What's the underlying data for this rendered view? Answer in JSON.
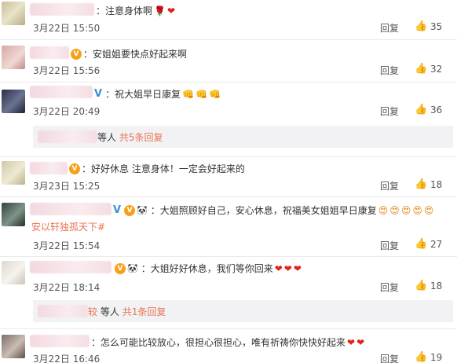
{
  "labels": {
    "reply": "回复",
    "like_icon": "thumbs-up-icon"
  },
  "comments": [
    {
      "text": "：注意身体啊",
      "emojis": [
        "🌹",
        "❤"
      ],
      "time": "3月22日 15:50",
      "likes": "35"
    },
    {
      "text": "：安姐姐要快点好起来啊",
      "emojis": [],
      "time": "3月22日 15:56",
      "likes": "32"
    },
    {
      "text": "：祝大姐早日康复",
      "emojis": [
        "👊",
        "👊",
        "👊"
      ],
      "time": "3月22日 20:49",
      "likes": "36",
      "sub": {
        "suffix": "等人",
        "link": "共5条回复"
      }
    },
    {
      "text": "：好好休息 注意身体！一定会好起来的",
      "emojis": [],
      "time": "3月23日 15:25",
      "likes": "18"
    },
    {
      "text": "：大姐照顾好自己，安心休息，祝福美女姐姐早日康复",
      "emojis": [
        "😍",
        "😍",
        "😍",
        "😍",
        "😍"
      ],
      "tag": "安以轩独孤天下#",
      "time": "3月22日 15:54",
      "likes": "27"
    },
    {
      "text": "：大姐好好休息，我们等你回来",
      "emojis": [
        "❤",
        "❤",
        "❤"
      ],
      "time": "3月22日 18:14",
      "likes": "18",
      "sub": {
        "name_tail": "较",
        "suffix": "等人",
        "link": "共1条回复"
      }
    },
    {
      "text": "：怎么可能比较放心，很担心很担心，唯有祈祷你快快好起来",
      "emojis": [
        "❤",
        "❤"
      ],
      "time": "3月22日 16:46",
      "likes": "19"
    }
  ]
}
